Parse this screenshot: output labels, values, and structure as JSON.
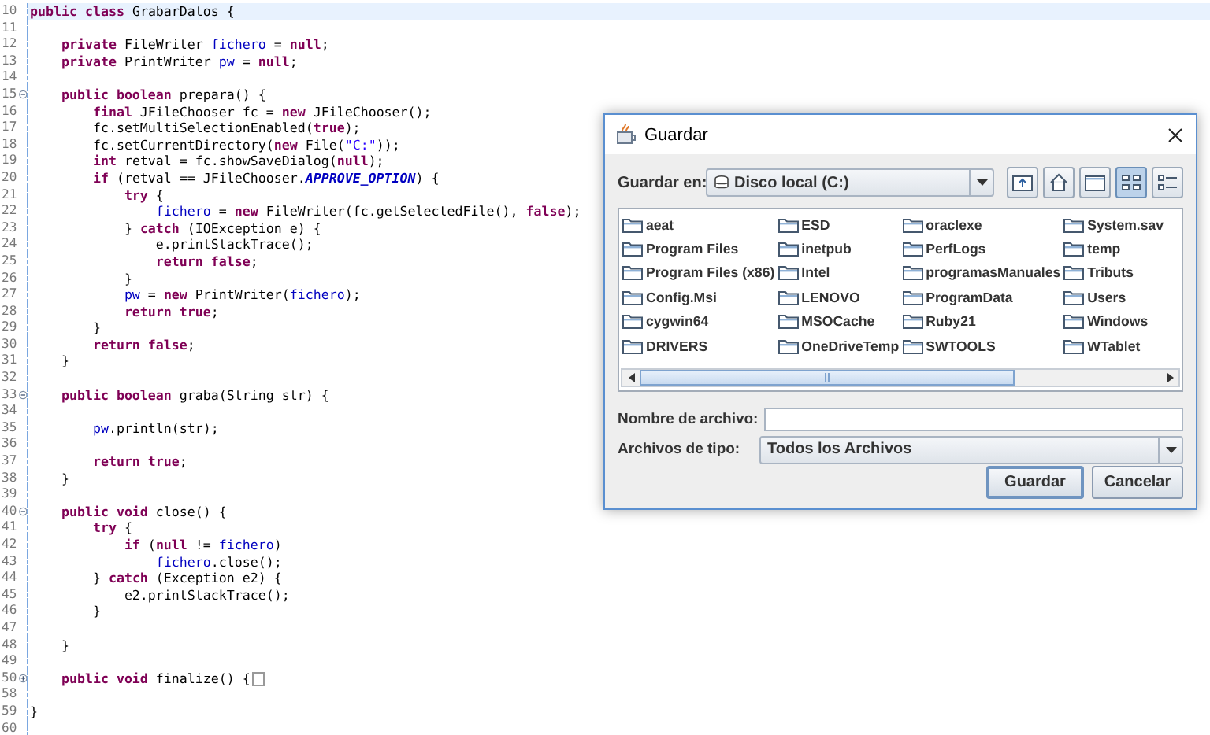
{
  "editor": {
    "lines": [
      {
        "number": "10",
        "current": true,
        "tokens": [
          {
            "kind": "kw",
            "text": "public class"
          },
          {
            "kind": "plain",
            "text": " GrabarDatos {"
          }
        ]
      },
      {
        "number": "11",
        "current": false
      },
      {
        "number": "12",
        "current": false,
        "tokens": [
          {
            "kind": "kw",
            "text": "    private"
          },
          {
            "kind": "plain",
            "text": " FileWriter "
          },
          {
            "kind": "field",
            "text": "fichero"
          },
          {
            "kind": "plain",
            "text": " = "
          },
          {
            "kind": "kw",
            "text": "null"
          },
          {
            "kind": "plain",
            "text": ";"
          }
        ]
      },
      {
        "number": "13",
        "current": false,
        "tokens": [
          {
            "kind": "kw",
            "text": "    private"
          },
          {
            "kind": "plain",
            "text": " PrintWriter "
          },
          {
            "kind": "field",
            "text": "pw"
          },
          {
            "kind": "plain",
            "text": " = "
          },
          {
            "kind": "kw",
            "text": "null"
          },
          {
            "kind": "plain",
            "text": ";"
          }
        ]
      },
      {
        "number": "14",
        "current": false
      },
      {
        "number": "15",
        "current": false,
        "folded": false,
        "tokens": [
          {
            "kind": "kw",
            "text": "    public boolean"
          },
          {
            "kind": "plain",
            "text": " prepara() {"
          }
        ]
      },
      {
        "number": "16",
        "current": false,
        "tokens": [
          {
            "kind": "kw",
            "text": "        final"
          },
          {
            "kind": "plain",
            "text": " JFileChooser fc = "
          },
          {
            "kind": "kw",
            "text": "new"
          },
          {
            "kind": "plain",
            "text": " JFileChooser();"
          }
        ]
      },
      {
        "number": "17",
        "current": false,
        "tokens": [
          {
            "kind": "plain",
            "text": "        fc.setMultiSelectionEnabled("
          },
          {
            "kind": "kw",
            "text": "true"
          },
          {
            "kind": "plain",
            "text": ");"
          }
        ]
      },
      {
        "number": "18",
        "current": false,
        "tokens": [
          {
            "kind": "plain",
            "text": "        fc.setCurrentDirectory("
          },
          {
            "kind": "kw",
            "text": "new"
          },
          {
            "kind": "plain",
            "text": " File("
          },
          {
            "kind": "str",
            "text": "\"C:\""
          },
          {
            "kind": "plain",
            "text": "));"
          }
        ]
      },
      {
        "number": "19",
        "current": false,
        "tokens": [
          {
            "kind": "kw",
            "text": "        int"
          },
          {
            "kind": "plain",
            "text": " retval = fc.showSaveDialog("
          },
          {
            "kind": "kw",
            "text": "null"
          },
          {
            "kind": "plain",
            "text": ");"
          }
        ]
      },
      {
        "number": "20",
        "current": false,
        "tokens": [
          {
            "kind": "kw",
            "text": "        if"
          },
          {
            "kind": "plain",
            "text": " (retval == JFileChooser."
          },
          {
            "kind": "const",
            "text": "APPROVE_OPTION"
          },
          {
            "kind": "plain",
            "text": ") {"
          }
        ]
      },
      {
        "number": "21",
        "current": false,
        "tokens": [
          {
            "kind": "kw",
            "text": "            try"
          },
          {
            "kind": "plain",
            "text": " {"
          }
        ]
      },
      {
        "number": "22",
        "current": false,
        "tokens": [
          {
            "kind": "field",
            "text": "                fichero"
          },
          {
            "kind": "plain",
            "text": " = "
          },
          {
            "kind": "kw",
            "text": "new"
          },
          {
            "kind": "plain",
            "text": " FileWriter(fc.getSelectedFile(), "
          },
          {
            "kind": "kw",
            "text": "false"
          },
          {
            "kind": "plain",
            "text": ");"
          }
        ]
      },
      {
        "number": "23",
        "current": false,
        "tokens": [
          {
            "kind": "plain",
            "text": "            } "
          },
          {
            "kind": "kw",
            "text": "catch"
          },
          {
            "kind": "plain",
            "text": " (IOException e) {"
          }
        ]
      },
      {
        "number": "24",
        "current": false,
        "tokens": [
          {
            "kind": "plain",
            "text": "                e.printStackTrace();"
          }
        ]
      },
      {
        "number": "25",
        "current": false,
        "tokens": [
          {
            "kind": "kw",
            "text": "                return false"
          },
          {
            "kind": "plain",
            "text": ";"
          }
        ]
      },
      {
        "number": "26",
        "current": false,
        "tokens": [
          {
            "kind": "plain",
            "text": "            }"
          }
        ]
      },
      {
        "number": "27",
        "current": false,
        "tokens": [
          {
            "kind": "field",
            "text": "            pw"
          },
          {
            "kind": "plain",
            "text": " = "
          },
          {
            "kind": "kw",
            "text": "new"
          },
          {
            "kind": "plain",
            "text": " PrintWriter("
          },
          {
            "kind": "field",
            "text": "fichero"
          },
          {
            "kind": "plain",
            "text": ");"
          }
        ]
      },
      {
        "number": "28",
        "current": false,
        "tokens": [
          {
            "kind": "kw",
            "text": "            return true"
          },
          {
            "kind": "plain",
            "text": ";"
          }
        ]
      },
      {
        "number": "29",
        "current": false,
        "tokens": [
          {
            "kind": "plain",
            "text": "        }"
          }
        ]
      },
      {
        "number": "30",
        "current": false,
        "tokens": [
          {
            "kind": "kw",
            "text": "        return false"
          },
          {
            "kind": "plain",
            "text": ";"
          }
        ]
      },
      {
        "number": "31",
        "current": false,
        "tokens": [
          {
            "kind": "plain",
            "text": "    }"
          }
        ]
      },
      {
        "number": "32",
        "current": false
      },
      {
        "number": "33",
        "current": false,
        "folded": false,
        "tokens": [
          {
            "kind": "kw",
            "text": "    public boolean"
          },
          {
            "kind": "plain",
            "text": " graba(String str) {"
          }
        ]
      },
      {
        "number": "34",
        "current": false
      },
      {
        "number": "35",
        "current": false,
        "tokens": [
          {
            "kind": "field",
            "text": "        pw"
          },
          {
            "kind": "plain",
            "text": ".println(str);"
          }
        ]
      },
      {
        "number": "36",
        "current": false
      },
      {
        "number": "37",
        "current": false,
        "tokens": [
          {
            "kind": "kw",
            "text": "        return true"
          },
          {
            "kind": "plain",
            "text": ";"
          }
        ]
      },
      {
        "number": "38",
        "current": false,
        "tokens": [
          {
            "kind": "plain",
            "text": "    }"
          }
        ]
      },
      {
        "number": "39",
        "current": false
      },
      {
        "number": "40",
        "current": false,
        "folded": false,
        "tokens": [
          {
            "kind": "kw",
            "text": "    public void"
          },
          {
            "kind": "plain",
            "text": " close() {"
          }
        ]
      },
      {
        "number": "41",
        "current": false,
        "tokens": [
          {
            "kind": "kw",
            "text": "        try"
          },
          {
            "kind": "plain",
            "text": " {"
          }
        ]
      },
      {
        "number": "42",
        "current": false,
        "tokens": [
          {
            "kind": "kw",
            "text": "            if"
          },
          {
            "kind": "plain",
            "text": " ("
          },
          {
            "kind": "kw",
            "text": "null"
          },
          {
            "kind": "plain",
            "text": " != "
          },
          {
            "kind": "field",
            "text": "fichero"
          },
          {
            "kind": "plain",
            "text": ")"
          }
        ]
      },
      {
        "number": "43",
        "current": false,
        "tokens": [
          {
            "kind": "field",
            "text": "                fichero"
          },
          {
            "kind": "plain",
            "text": ".close();"
          }
        ]
      },
      {
        "number": "44",
        "current": false,
        "tokens": [
          {
            "kind": "plain",
            "text": "        } "
          },
          {
            "kind": "kw",
            "text": "catch"
          },
          {
            "kind": "plain",
            "text": " (Exception e2) {"
          }
        ]
      },
      {
        "number": "45",
        "current": false,
        "tokens": [
          {
            "kind": "plain",
            "text": "            e2.printStackTrace();"
          }
        ]
      },
      {
        "number": "46",
        "current": false,
        "tokens": [
          {
            "kind": "plain",
            "text": "        }"
          }
        ]
      },
      {
        "number": "47",
        "current": false
      },
      {
        "number": "48",
        "current": false,
        "tokens": [
          {
            "kind": "plain",
            "text": "    }"
          }
        ]
      },
      {
        "number": "49",
        "current": false
      },
      {
        "number": "50",
        "current": false,
        "folded": true,
        "tokens": [
          {
            "kind": "kw",
            "text": "    public void"
          },
          {
            "kind": "plain",
            "text": " finalize() {"
          }
        ]
      },
      {
        "number": "58",
        "current": false
      },
      {
        "number": "59",
        "current": false,
        "tokens": [
          {
            "kind": "plain",
            "text": "}"
          }
        ]
      },
      {
        "number": "60",
        "current": false
      }
    ]
  },
  "dialog": {
    "title": "Guardar",
    "look_in": {
      "label": "Guardar en:",
      "value": "Disco local (C:)"
    },
    "toolbar": [
      {
        "kind": "up",
        "selected": false
      },
      {
        "kind": "home",
        "selected": false
      },
      {
        "kind": "new-folder",
        "selected": false
      },
      {
        "kind": "list",
        "selected": true
      },
      {
        "kind": "details",
        "selected": false
      }
    ],
    "files": [
      "aeat",
      "Program Files",
      "Program Files (x86)",
      "Config.Msi",
      "cygwin64",
      "DRIVERS",
      "ESD",
      "inetpub",
      "Intel",
      "LENOVO",
      "MSOCache",
      "OneDriveTemp",
      "oraclexe",
      "PerfLogs",
      "programasManuales",
      "ProgramData",
      "Ruby21",
      "SWTOOLS",
      "System.sav",
      "temp",
      "Tributs",
      "Users",
      "Windows",
      "WTablet"
    ],
    "file_name": {
      "label": "Nombre de archivo:"
    },
    "file_type": {
      "label": "Archivos de tipo:",
      "value": "Todos los Archivos"
    },
    "buttons": [
      "Guardar",
      "Cancelar"
    ]
  }
}
